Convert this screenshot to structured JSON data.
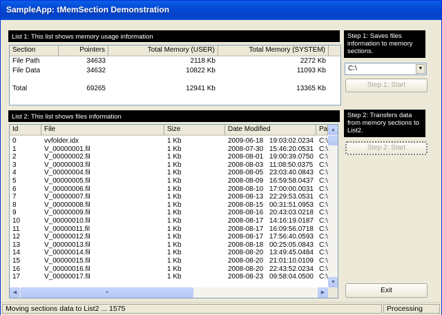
{
  "window": {
    "title": "SampleApp: tMemSection Demonstration"
  },
  "list1": {
    "banner": "List 1: This list shows memory usage information",
    "columns": [
      "Section",
      "Pointers",
      "Total Memory (USER)",
      "Total Memory (SYSTEM)"
    ],
    "rows": [
      [
        "File Path",
        "34633",
        "2118 Kb",
        "2272 Kb"
      ],
      [
        "File Data",
        "34632",
        "10822 Kb",
        "11093 Kb"
      ],
      [
        "",
        "",
        "",
        ""
      ],
      [
        "Total",
        "69265",
        "12941 Kb",
        "13365 Kb"
      ]
    ]
  },
  "list2": {
    "banner": "List 2: This list shows files information",
    "columns": [
      "Id",
      "File",
      "Size",
      "Date Modified",
      "Pa"
    ],
    "rows": [
      [
        "0",
        "vvfolder.idx",
        "1 Kb",
        "2009-06-18",
        "19:03:02.0234",
        "C:\\"
      ],
      [
        "1",
        "V_00000001.fil",
        "1 Kb",
        "2008-07-30",
        "15:46:20.0531",
        "C:\\"
      ],
      [
        "2",
        "V_00000002.fil",
        "1 Kb",
        "2008-08-01",
        "19:00:39.0750",
        "C:\\"
      ],
      [
        "3",
        "V_00000003.fil",
        "1 Kb",
        "2008-08-03",
        "11:08:50.0375",
        "C:\\"
      ],
      [
        "4",
        "V_00000004.fil",
        "1 Kb",
        "2008-08-05",
        "23:03:40.0843",
        "C:\\"
      ],
      [
        "5",
        "V_00000005.fil",
        "1 Kb",
        "2008-08-09",
        "16:59:58.0437",
        "C:\\"
      ],
      [
        "6",
        "V_00000006.fil",
        "1 Kb",
        "2008-08-10",
        "17:00:00.0031",
        "C:\\"
      ],
      [
        "7",
        "V_00000007.fil",
        "1 Kb",
        "2008-08-13",
        "22:29:53.0531",
        "C:\\"
      ],
      [
        "8",
        "V_00000008.fil",
        "1 Kb",
        "2008-08-15",
        "00:31:51.0953",
        "C:\\"
      ],
      [
        "9",
        "V_00000009.fil",
        "1 Kb",
        "2008-08-16",
        "20:43:03.0218",
        "C:\\"
      ],
      [
        "10",
        "V_00000010.fil",
        "1 Kb",
        "2008-08-17",
        "14:16:19.0187",
        "C:\\"
      ],
      [
        "11",
        "V_00000011.fil",
        "1 Kb",
        "2008-08-17",
        "16:09:56.0718",
        "C:\\"
      ],
      [
        "12",
        "V_00000012.fil",
        "1 Kb",
        "2008-08-17",
        "17:56:40.0593",
        "C:\\"
      ],
      [
        "13",
        "V_00000013.fil",
        "1 Kb",
        "2008-08-18",
        "00:25:05.0843",
        "C:\\"
      ],
      [
        "14",
        "V_00000014.fil",
        "1 Kb",
        "2008-08-20",
        "13:49:45.0484",
        "C:\\"
      ],
      [
        "15",
        "V_00000015.fil",
        "1 Kb",
        "2008-08-20",
        "21:01:10.0109",
        "C:\\"
      ],
      [
        "16",
        "V_00000016.fil",
        "1 Kb",
        "2008-08-20",
        "22:43:52.0234",
        "C:\\"
      ],
      [
        "17",
        "V_00000017.fil",
        "1 Kb",
        "2008-08-23",
        "09:58:04.0500",
        "C:\\"
      ]
    ]
  },
  "step1": {
    "text": "Step 1: Saves files information to memory sections.",
    "drive": "C:\\",
    "button": "Step 1: Start"
  },
  "step2": {
    "text": "Step 2: Transfers data from memory sections to List2.",
    "button": "Step 2: Start"
  },
  "exit_button": "Exit",
  "status": {
    "message": "Moving sections data to List2 ... 1575",
    "state": "Processing"
  },
  "colors": {
    "title_bar": "#0349d4",
    "banner": "#000000",
    "window_bg": "#ece9d8"
  }
}
